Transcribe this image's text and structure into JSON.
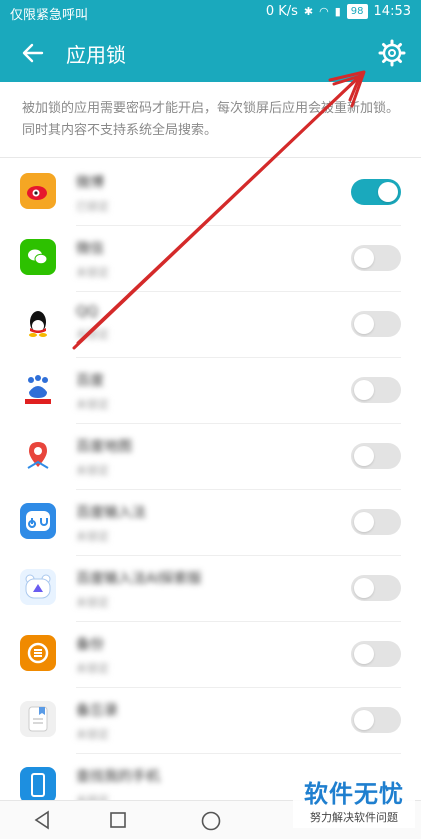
{
  "statusbar": {
    "carrier": "仅限紧急呼叫",
    "speed": "0 K/s",
    "battery": "98",
    "time": "14:53"
  },
  "appbar": {
    "title": "应用锁"
  },
  "description": "被加锁的应用需要密码才能开启，每次锁屏后应用会被重新加锁。同时其内容不支持系统全局搜索。",
  "apps": [
    {
      "name": "微博",
      "status": "已锁定",
      "enabled": true,
      "icon": "weibo-icon",
      "color": "#f5a623"
    },
    {
      "name": "微信",
      "status": "未锁定",
      "enabled": false,
      "icon": "wechat-icon",
      "color": "#2dc100"
    },
    {
      "name": "QQ",
      "status": "未锁定",
      "enabled": false,
      "icon": "qq-icon",
      "color": "#ffffff"
    },
    {
      "name": "百度",
      "status": "未锁定",
      "enabled": false,
      "icon": "baidu-icon",
      "color": "#2f6fd8"
    },
    {
      "name": "百度地图",
      "status": "未锁定",
      "enabled": false,
      "icon": "baidu-map-icon",
      "color": "#ffffff"
    },
    {
      "name": "百度输入法",
      "status": "未锁定",
      "enabled": false,
      "icon": "baidu-input-icon",
      "color": "#2f8be6"
    },
    {
      "name": "百度输入法AI探索版",
      "status": "未锁定",
      "enabled": false,
      "icon": "baidu-input-ai-icon",
      "color": "#e8f3ff"
    },
    {
      "name": "备份",
      "status": "未锁定",
      "enabled": false,
      "icon": "backup-icon",
      "color": "#f08a00"
    },
    {
      "name": "备忘录",
      "status": "未锁定",
      "enabled": false,
      "icon": "memo-icon",
      "color": "#f0f0f0"
    },
    {
      "name": "查找我的手机",
      "status": "未锁定",
      "enabled": false,
      "icon": "find-phone-icon",
      "color": "#1d8fe0"
    }
  ],
  "watermark": {
    "line1": "软件无忧",
    "line2": "努力解决软件问题"
  },
  "colors": {
    "accent": "#1aa9bd",
    "arrow": "#d42a2a"
  }
}
